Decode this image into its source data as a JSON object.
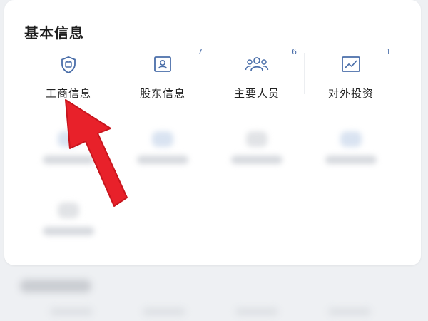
{
  "section": {
    "title": "基本信息"
  },
  "tiles": [
    {
      "label": "工商信息",
      "badge": "",
      "icon": "shield-icon"
    },
    {
      "label": "股东信息",
      "badge": "7",
      "icon": "id-card-icon"
    },
    {
      "label": "主要人员",
      "badge": "6",
      "icon": "people-icon"
    },
    {
      "label": "对外投资",
      "badge": "1",
      "icon": "trend-chart-icon"
    }
  ],
  "colors": {
    "accent": "#4a6ea9",
    "arrow": "#e8212a",
    "background": "#eef0f3"
  }
}
